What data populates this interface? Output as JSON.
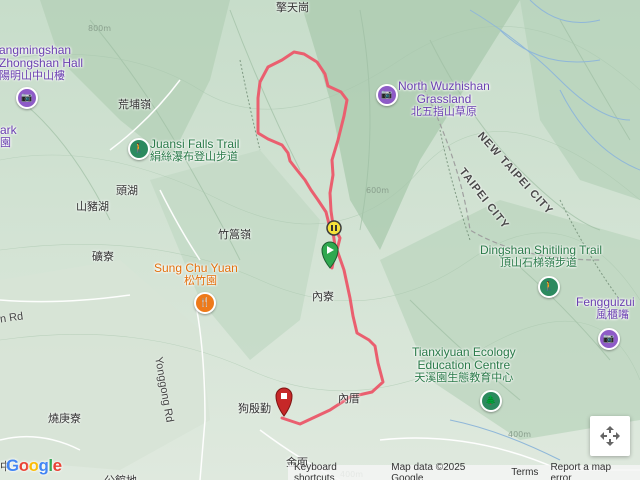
{
  "labels": {
    "top_edge": "擎天崗",
    "yangmingshan": "angmingshan",
    "zhongshan_hall_en": "Zhongshan Hall",
    "zhongshan_hall_zh": "陽明山中山樓",
    "park": "ark",
    "park_zh": "園",
    "huangxi": "荒埔嶺",
    "juansi_en": "Juansi Falls Trail",
    "juansi_zh": "絹絲瀑布登山步道",
    "touhu": "頭湖",
    "shanzhu": "山豬湖",
    "zhuhao": "竹篙嶺",
    "kuangliao": "礦寮",
    "sungchu_en": "Sung Chu Yuan",
    "sungchu_zh": "松竹園",
    "neiliao": "內寮",
    "neicuo": "內厝",
    "gouyin": "狗殷勤",
    "jinmian": "金面",
    "shaokang": "燒庚寮",
    "zhong": "中",
    "gongguan": "公館地",
    "north_wuzhi_en": "North Wuzhishan",
    "north_wuzhi_en2": "Grassland",
    "north_wuzhi_zh": "北五指山草原",
    "new_taipei": "NEW TAIPEI CITY",
    "taipei": "TAIPEI CITY",
    "dingshan_en": "Dingshan Shitiling Trail",
    "dingshan_zh": "頂山石梯嶺步道",
    "fengguizui_en": "Fengguizui",
    "fengguizui_zh": "風櫃嘴",
    "tianxi_en": "Tianxiyuan Ecology",
    "tianxi_en2": "Education Centre",
    "tianxi_zh": "天溪園生態教育中心",
    "rd_left": "n Rd",
    "yonggong_rd": "Yonggong Rd",
    "elev_800": "800m",
    "elev_600": "600m",
    "elev_400": "400m",
    "elev_400b": "400m"
  },
  "icons": {
    "camera": "📷",
    "hiker": "🚶",
    "fork_knife": "🍴",
    "tree": "🌲"
  },
  "footer": {
    "keyboard": "Keyboard shortcuts",
    "map_data": "Map data ©2025 Google",
    "terms": "Terms",
    "report": "Report a map error"
  },
  "logo": {
    "g1": "G",
    "o1": "o",
    "o2": "o",
    "g2": "g",
    "l": "l",
    "e": "e"
  },
  "colors": {
    "track": "#ea5f6f",
    "start_marker": "#2fa84f",
    "end_marker": "#c62828",
    "pause_marker": "#f5e13a"
  }
}
